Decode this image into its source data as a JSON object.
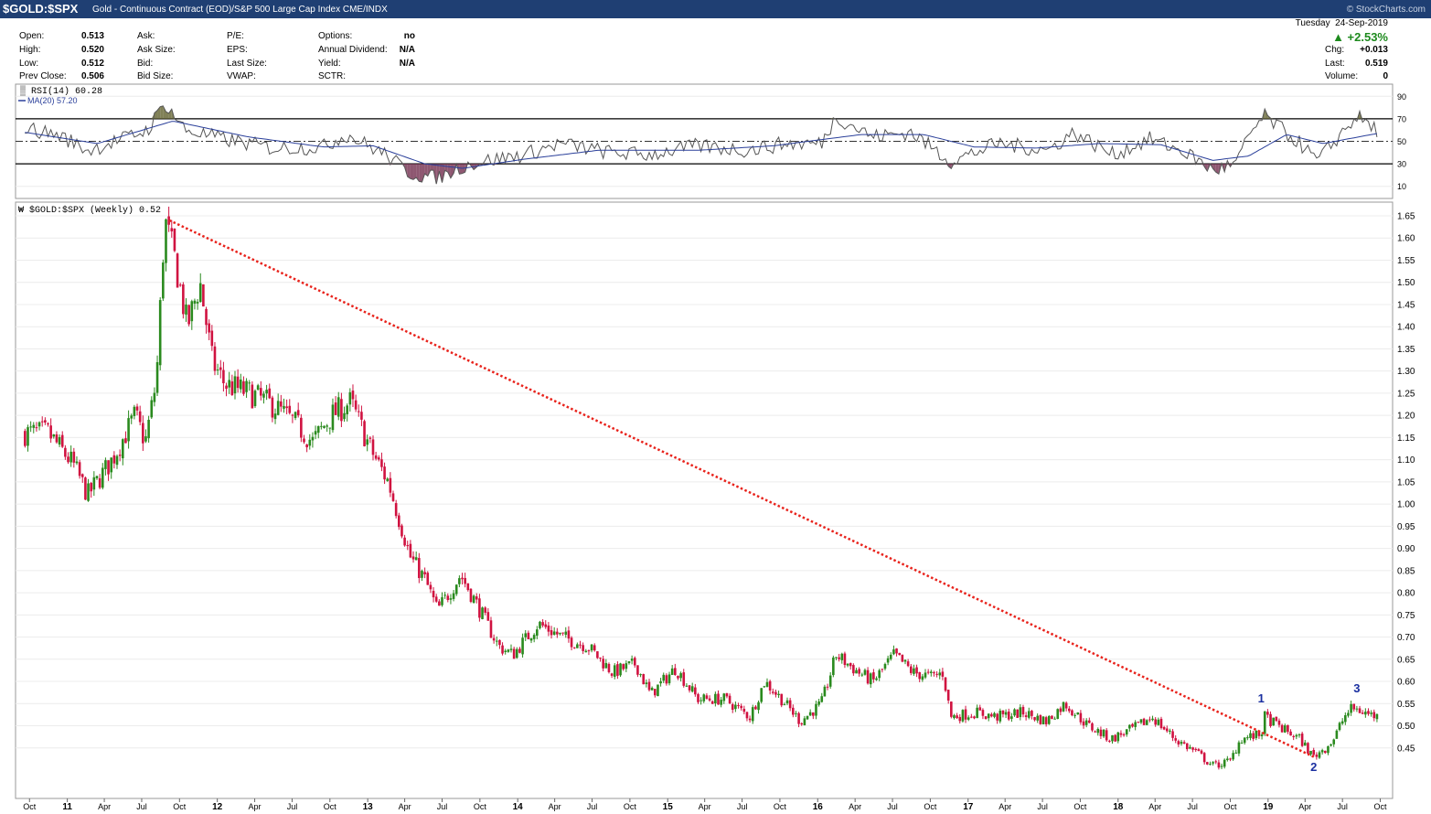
{
  "title": {
    "symbol": "$GOLD:$SPX",
    "description": "Gold - Continuous Contract (EOD)/S&P 500 Large Cap Index",
    "exchange": "CME/INDX",
    "credit": "© StockCharts.com"
  },
  "quote": {
    "open_label": "Open:",
    "open": "0.513",
    "high_label": "High:",
    "high": "0.520",
    "low_label": "Low:",
    "low": "0.512",
    "prev_close_label": "Prev Close:",
    "prev_close": "0.506",
    "ask_label": "Ask:",
    "ask_size_label": "Ask Size:",
    "bid_label": "Bid:",
    "bid_size_label": "Bid Size:",
    "pe_label": "P/E:",
    "eps_label": "EPS:",
    "last_size_label": "Last Size:",
    "vwap_label": "VWAP:",
    "options_label": "Options:",
    "options": "no",
    "dividend_label": "Annual Dividend:",
    "dividend": "N/A",
    "yield_label": "Yield:",
    "yield": "N/A",
    "sctr_label": "SCTR:",
    "day": "Tuesday",
    "date": "24-Sep-2019",
    "pct_change": "▲ +2.53%",
    "chg_label": "Chg:",
    "chg": "+0.013",
    "last_label": "Last:",
    "last": "0.519",
    "volume_label": "Volume:",
    "volume": "0",
    "up_color": "#1d8a1d"
  },
  "rsi_panel": {
    "legend_rsi": "RSI(14) 60.28",
    "legend_ma": "MA(20) 57.20",
    "yticks": [
      "90",
      "70",
      "50",
      "30",
      "10"
    ]
  },
  "price_panel": {
    "legend": "$GOLD:$SPX (Weekly) 0.52",
    "up_color": "#2a8a1e",
    "down_color": "#d01240",
    "trendline_color": "#e8231c"
  },
  "chart_data": {
    "type": "candlestick",
    "series": "$GOLD:$SPX (Weekly)",
    "ylim": [
      0.4,
      1.68
    ],
    "yticks": [
      "1.65",
      "1.60",
      "1.55",
      "1.50",
      "1.45",
      "1.40",
      "1.35",
      "1.30",
      "1.25",
      "1.20",
      "1.15",
      "1.10",
      "1.05",
      "1.00",
      "0.95",
      "0.90",
      "0.85",
      "0.80",
      "0.75",
      "0.70",
      "0.65",
      "0.60",
      "0.55",
      "0.50",
      "0.45"
    ],
    "xticks": [
      "Oct",
      "11",
      "Apr",
      "Jul",
      "Oct",
      "12",
      "Apr",
      "Jul",
      "Oct",
      "13",
      "Apr",
      "Jul",
      "Oct",
      "14",
      "Apr",
      "Jul",
      "Oct",
      "15",
      "Apr",
      "Jul",
      "Oct",
      "16",
      "Apr",
      "Jul",
      "Oct",
      "17",
      "Apr",
      "Jul",
      "Oct",
      "18",
      "Apr",
      "Jul",
      "Oct",
      "19",
      "Apr",
      "Jul",
      "Oct"
    ],
    "path": [
      [
        "2010-09-20",
        1.16
      ],
      [
        "2010-11-15",
        1.16
      ],
      [
        "2011-01-15",
        1.09
      ],
      [
        "2011-02-20",
        1.02
      ],
      [
        "2011-04-20",
        1.1
      ],
      [
        "2011-06-15",
        1.2
      ],
      [
        "2011-07-10",
        1.14
      ],
      [
        "2011-08-06",
        1.28
      ],
      [
        "2011-08-26",
        1.64
      ],
      [
        "2011-09-20",
        1.55
      ],
      [
        "2011-10-20",
        1.4
      ],
      [
        "2011-11-20",
        1.5
      ],
      [
        "2011-12-20",
        1.32
      ],
      [
        "2012-01-20",
        1.27
      ],
      [
        "2012-03-20",
        1.25
      ],
      [
        "2012-05-20",
        1.22
      ],
      [
        "2012-07-10",
        1.18
      ],
      [
        "2012-08-20",
        1.14
      ],
      [
        "2012-10-05",
        1.2
      ],
      [
        "2012-11-20",
        1.23
      ],
      [
        "2013-01-10",
        1.12
      ],
      [
        "2013-02-20",
        1.05
      ],
      [
        "2013-04-15",
        0.88
      ],
      [
        "2013-05-20",
        0.83
      ],
      [
        "2013-06-20",
        0.76
      ],
      [
        "2013-08-15",
        0.84
      ],
      [
        "2013-09-20",
        0.78
      ],
      [
        "2013-11-15",
        0.68
      ],
      [
        "2013-12-20",
        0.66
      ],
      [
        "2014-02-20",
        0.73
      ],
      [
        "2014-04-20",
        0.7
      ],
      [
        "2014-06-20",
        0.68
      ],
      [
        "2014-08-20",
        0.62
      ],
      [
        "2014-10-15",
        0.64
      ],
      [
        "2014-11-20",
        0.57
      ],
      [
        "2015-01-20",
        0.63
      ],
      [
        "2015-03-15",
        0.56
      ],
      [
        "2015-05-20",
        0.56
      ],
      [
        "2015-07-20",
        0.52
      ],
      [
        "2015-08-25",
        0.6
      ],
      [
        "2015-10-05",
        0.56
      ],
      [
        "2015-11-20",
        0.51
      ],
      [
        "2016-01-10",
        0.55
      ],
      [
        "2016-02-15",
        0.66
      ],
      [
        "2016-04-10",
        0.62
      ],
      [
        "2016-05-15",
        0.6
      ],
      [
        "2016-07-05",
        0.66
      ],
      [
        "2016-08-20",
        0.62
      ],
      [
        "2016-10-05",
        0.61
      ],
      [
        "2016-11-01",
        0.62
      ],
      [
        "2016-11-20",
        0.52
      ],
      [
        "2017-01-20",
        0.53
      ],
      [
        "2017-03-10",
        0.52
      ],
      [
        "2017-05-15",
        0.53
      ],
      [
        "2017-07-10",
        0.51
      ],
      [
        "2017-08-25",
        0.55
      ],
      [
        "2017-10-20",
        0.5
      ],
      [
        "2017-12-15",
        0.47
      ],
      [
        "2018-02-20",
        0.5
      ],
      [
        "2018-03-25",
        0.52
      ],
      [
        "2018-05-20",
        0.47
      ],
      [
        "2018-07-10",
        0.44
      ],
      [
        "2018-08-20",
        0.41
      ],
      [
        "2018-10-01",
        0.42
      ],
      [
        "2018-10-25",
        0.47
      ],
      [
        "2018-12-15",
        0.48
      ],
      [
        "2018-12-24",
        0.52
      ],
      [
        "2019-02-10",
        0.49
      ],
      [
        "2019-03-20",
        0.47
      ],
      [
        "2019-04-20",
        0.43
      ],
      [
        "2019-05-20",
        0.45
      ],
      [
        "2019-06-10",
        0.47
      ],
      [
        "2019-07-05",
        0.52
      ],
      [
        "2019-07-25",
        0.54
      ],
      [
        "2019-09-24",
        0.52
      ]
    ],
    "trendline": [
      [
        "2011-09-06",
        1.64
      ],
      [
        "2019-04-22",
        0.43
      ]
    ],
    "wave_labels": [
      {
        "label": "1",
        "date": "2018-12-15",
        "value": 0.553
      },
      {
        "label": "2",
        "date": "2019-04-22",
        "value": 0.398
      },
      {
        "label": "3",
        "date": "2019-08-05",
        "value": 0.575
      }
    ],
    "rsi": {
      "name": "RSI(14)",
      "ylim": [
        0,
        100
      ],
      "overbought": 70,
      "oversold": 30,
      "midline": 50,
      "path": [
        [
          "2010-09-20",
          62
        ],
        [
          "2010-12-15",
          55
        ],
        [
          "2011-02-20",
          42
        ],
        [
          "2011-05-15",
          52
        ],
        [
          "2011-07-15",
          60
        ],
        [
          "2011-08-26",
          84
        ],
        [
          "2011-10-15",
          60
        ],
        [
          "2012-01-15",
          52
        ],
        [
          "2012-05-15",
          44
        ],
        [
          "2012-09-15",
          45
        ],
        [
          "2012-11-10",
          56
        ],
        [
          "2013-02-15",
          38
        ],
        [
          "2013-04-10",
          22
        ],
        [
          "2013-06-20",
          17
        ],
        [
          "2013-08-20",
          28
        ],
        [
          "2013-10-20",
          33
        ],
        [
          "2014-01-15",
          38
        ],
        [
          "2014-04-15",
          48
        ],
        [
          "2014-08-15",
          40
        ],
        [
          "2014-11-15",
          38
        ],
        [
          "2015-03-15",
          46
        ],
        [
          "2015-07-15",
          42
        ],
        [
          "2015-10-15",
          48
        ],
        [
          "2016-01-10",
          48
        ],
        [
          "2016-02-15",
          72
        ],
        [
          "2016-05-15",
          54
        ],
        [
          "2016-08-15",
          58
        ],
        [
          "2016-11-20",
          32
        ],
        [
          "2017-03-15",
          48
        ],
        [
          "2017-07-15",
          42
        ],
        [
          "2017-09-15",
          58
        ],
        [
          "2017-12-20",
          38
        ],
        [
          "2018-03-20",
          52
        ],
        [
          "2018-06-15",
          40
        ],
        [
          "2018-08-20",
          24
        ],
        [
          "2018-10-15",
          30
        ],
        [
          "2018-11-20",
          58
        ],
        [
          "2018-12-24",
          72
        ],
        [
          "2019-03-20",
          48
        ],
        [
          "2019-05-01",
          32
        ],
        [
          "2019-07-05",
          60
        ],
        [
          "2019-08-05",
          72
        ],
        [
          "2019-09-24",
          60
        ]
      ],
      "ma_name": "MA(20)",
      "ma_path": [
        [
          "2010-09-20",
          58
        ],
        [
          "2011-03-15",
          48
        ],
        [
          "2011-09-15",
          68
        ],
        [
          "2012-03-15",
          54
        ],
        [
          "2012-09-15",
          45
        ],
        [
          "2013-01-15",
          46
        ],
        [
          "2013-05-20",
          30
        ],
        [
          "2013-08-20",
          26
        ],
        [
          "2014-01-15",
          34
        ],
        [
          "2014-07-15",
          42
        ],
        [
          "2015-03-15",
          42
        ],
        [
          "2015-09-15",
          46
        ],
        [
          "2016-04-15",
          56
        ],
        [
          "2016-09-15",
          56
        ],
        [
          "2017-01-15",
          45
        ],
        [
          "2017-06-15",
          44
        ],
        [
          "2017-11-15",
          48
        ],
        [
          "2018-04-15",
          47
        ],
        [
          "2018-08-20",
          33
        ],
        [
          "2018-11-15",
          37
        ],
        [
          "2019-02-15",
          56
        ],
        [
          "2019-05-15",
          48
        ],
        [
          "2019-09-24",
          57
        ]
      ]
    }
  }
}
